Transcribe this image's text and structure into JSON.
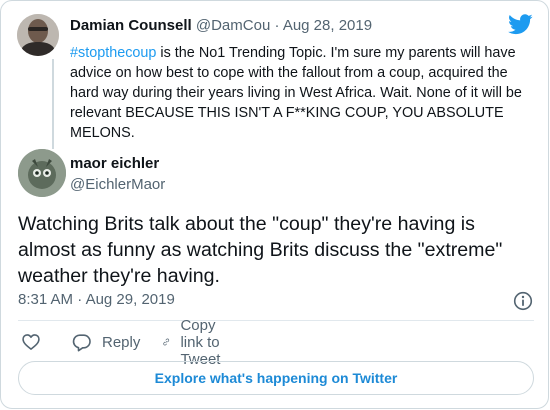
{
  "parent_tweet": {
    "name": "Damian Counsell",
    "handle": "@DamCou",
    "separator": "·",
    "date": "Aug 28, 2019",
    "hashtag": "#stopthecoup",
    "text": " is the No1 Trending Topic. I'm sure my parents will have advice on how best to cope with the fallout from a coup, acquired the hard way during their years living in West Africa. Wait. None of it will be relevant BECAUSE THIS ISN'T A F**KING COUP, YOU ABSOLUTE MELONS."
  },
  "tweet": {
    "name": "maor eichler",
    "handle": "@EichlerMaor",
    "text": "Watching Brits talk about the \"coup\" they're having is almost as funny as watching Brits discuss the \"extreme\" weather they're having.",
    "time": "8:31 AM",
    "separator": "·",
    "date": "Aug 29, 2019"
  },
  "actions": {
    "reply_label": "Reply",
    "copy_label": "Copy link to Tweet"
  },
  "explore_label": "Explore what's happening on Twitter",
  "colors": {
    "accent": "#1d9bf0",
    "muted": "#536471",
    "border": "#cfd9de"
  },
  "icons": [
    "twitter-bird-icon",
    "info-icon",
    "heart-icon",
    "reply-icon",
    "link-icon"
  ]
}
